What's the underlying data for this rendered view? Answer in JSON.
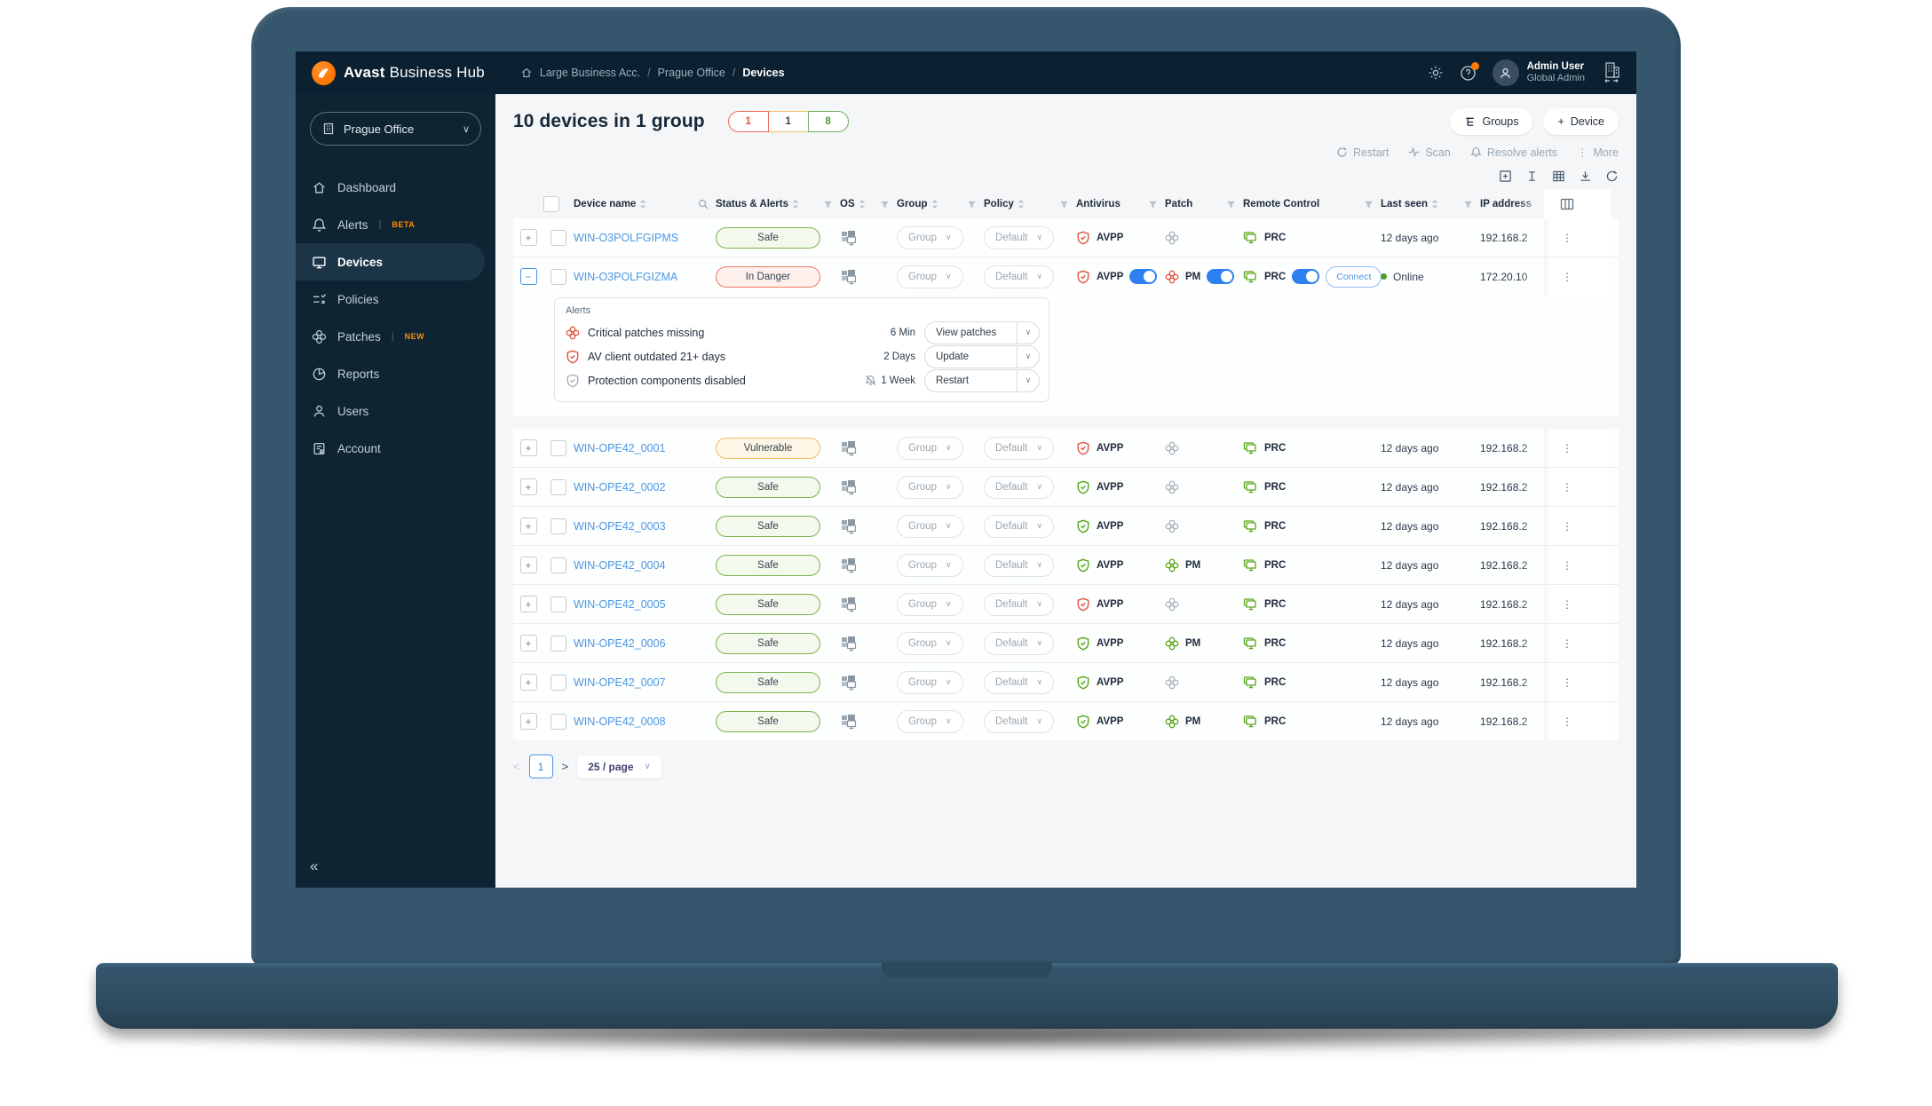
{
  "header": {
    "logo_bold": "Avast",
    "logo_rest": " Business Hub",
    "breadcrumb": [
      "Large Business Acc.",
      "Prague Office",
      "Devices"
    ],
    "user_name": "Admin User",
    "user_role": "Global Admin",
    "icons": [
      "gear-icon",
      "help-icon",
      "avatar",
      "company-switch-icon"
    ]
  },
  "sidebar": {
    "org_selector": "Prague Office",
    "items": [
      {
        "label": "Dashboard",
        "icon": "home",
        "badge": "",
        "active": false
      },
      {
        "label": "Alerts",
        "icon": "bell",
        "badge": "BETA",
        "active": false
      },
      {
        "label": "Devices",
        "icon": "monitor",
        "badge": "",
        "active": true
      },
      {
        "label": "Policies",
        "icon": "policies",
        "badge": "",
        "active": false
      },
      {
        "label": "Patches",
        "icon": "patch",
        "badge": "NEW",
        "active": false
      },
      {
        "label": "Reports",
        "icon": "pie",
        "badge": "",
        "active": false
      },
      {
        "label": "Users",
        "icon": "person",
        "badge": "",
        "active": false
      },
      {
        "label": "Account",
        "icon": "doc",
        "badge": "",
        "active": false
      }
    ],
    "collapse_glyph": "«"
  },
  "main": {
    "title": "10 devices in 1 group",
    "summary_badges": [
      {
        "count": "1",
        "color": "red"
      },
      {
        "count": "1",
        "color": "amber"
      },
      {
        "count": "8",
        "color": "green"
      }
    ],
    "groups_button": "Groups",
    "device_button": "Device",
    "device_button_plus": "+",
    "toolbar": [
      {
        "label": "Restart",
        "icon": "restart"
      },
      {
        "label": "Scan",
        "icon": "scan"
      },
      {
        "label": "Resolve alerts",
        "icon": "bell"
      },
      {
        "label": "More",
        "icon": "more"
      }
    ]
  },
  "table": {
    "columns": {
      "device_name": "Device name",
      "status": "Status & Alerts",
      "os": "OS",
      "group": "Group",
      "policy": "Policy",
      "antivirus": "Antivirus",
      "patch": "Patch",
      "remote": "Remote Control",
      "last_seen": "Last seen",
      "ip": "IP address"
    },
    "rows": [
      {
        "name": "WIN-O3POLFGIPMS",
        "status": "Safe",
        "status_type": "safe",
        "expanded": false,
        "group": "Group",
        "policy": "Default",
        "av": "red",
        "av_label": "AVPP",
        "av_toggle": false,
        "patch": "grey",
        "patch_label": "",
        "patch_toggle": false,
        "rc_label": "PRC",
        "rc_toggle": false,
        "connect": false,
        "last_seen": "12 days ago",
        "online": false,
        "ip": "192.168.2"
      },
      {
        "name": "WIN-O3POLFGIZMA",
        "status": "In Danger",
        "status_type": "danger",
        "expanded": true,
        "group": "Group",
        "policy": "Default",
        "av": "red",
        "av_label": "AVPP",
        "av_toggle": true,
        "patch": "red",
        "patch_label": "PM",
        "patch_toggle": true,
        "rc_label": "PRC",
        "rc_toggle": true,
        "connect": true,
        "connect_label": "Connect",
        "last_seen": "Online",
        "online": true,
        "ip": "172.20.10"
      },
      {
        "name": "WIN-OPE42_0001",
        "status": "Vulnerable",
        "status_type": "vuln",
        "expanded": false,
        "group": "Group",
        "policy": "Default",
        "av": "red",
        "av_label": "AVPP",
        "av_toggle": false,
        "patch": "grey",
        "patch_label": "",
        "patch_toggle": false,
        "rc_label": "PRC",
        "rc_toggle": false,
        "connect": false,
        "last_seen": "12 days ago",
        "online": false,
        "ip": "192.168.2"
      },
      {
        "name": "WIN-OPE42_0002",
        "status": "Safe",
        "status_type": "safe",
        "expanded": false,
        "group": "Group",
        "policy": "Default",
        "av": "green",
        "av_label": "AVPP",
        "av_toggle": false,
        "patch": "grey",
        "patch_label": "",
        "patch_toggle": false,
        "rc_label": "PRC",
        "rc_toggle": false,
        "connect": false,
        "last_seen": "12 days ago",
        "online": false,
        "ip": "192.168.2"
      },
      {
        "name": "WIN-OPE42_0003",
        "status": "Safe",
        "status_type": "safe",
        "expanded": false,
        "group": "Group",
        "policy": "Default",
        "av": "green",
        "av_label": "AVPP",
        "av_toggle": false,
        "patch": "grey",
        "patch_label": "",
        "patch_toggle": false,
        "rc_label": "PRC",
        "rc_toggle": false,
        "connect": false,
        "last_seen": "12 days ago",
        "online": false,
        "ip": "192.168.2"
      },
      {
        "name": "WIN-OPE42_0004",
        "status": "Safe",
        "status_type": "safe",
        "expanded": false,
        "group": "Group",
        "policy": "Default",
        "av": "green",
        "av_label": "AVPP",
        "av_toggle": false,
        "patch": "green",
        "patch_label": "PM",
        "patch_toggle": false,
        "rc_label": "PRC",
        "rc_toggle": false,
        "connect": false,
        "last_seen": "12 days ago",
        "online": false,
        "ip": "192.168.2"
      },
      {
        "name": "WIN-OPE42_0005",
        "status": "Safe",
        "status_type": "safe",
        "expanded": false,
        "group": "Group",
        "policy": "Default",
        "av": "red",
        "av_label": "AVPP",
        "av_toggle": false,
        "patch": "grey",
        "patch_label": "",
        "patch_toggle": false,
        "rc_label": "PRC",
        "rc_toggle": false,
        "connect": false,
        "last_seen": "12 days ago",
        "online": false,
        "ip": "192.168.2"
      },
      {
        "name": "WIN-OPE42_0006",
        "status": "Safe",
        "status_type": "safe",
        "expanded": false,
        "group": "Group",
        "policy": "Default",
        "av": "green",
        "av_label": "AVPP",
        "av_toggle": false,
        "patch": "green",
        "patch_label": "PM",
        "patch_toggle": false,
        "rc_label": "PRC",
        "rc_toggle": false,
        "connect": false,
        "last_seen": "12 days ago",
        "online": false,
        "ip": "192.168.2"
      },
      {
        "name": "WIN-OPE42_0007",
        "status": "Safe",
        "status_type": "safe",
        "expanded": false,
        "group": "Group",
        "policy": "Default",
        "av": "green",
        "av_label": "AVPP",
        "av_toggle": false,
        "patch": "grey",
        "patch_label": "",
        "patch_toggle": false,
        "rc_label": "PRC",
        "rc_toggle": false,
        "connect": false,
        "last_seen": "12 days ago",
        "online": false,
        "ip": "192.168.2"
      },
      {
        "name": "WIN-OPE42_0008",
        "status": "Safe",
        "status_type": "safe",
        "expanded": false,
        "group": "Group",
        "policy": "Default",
        "av": "green",
        "av_label": "AVPP",
        "av_toggle": false,
        "patch": "green",
        "patch_label": "PM",
        "patch_toggle": false,
        "rc_label": "PRC",
        "rc_toggle": false,
        "connect": false,
        "last_seen": "12 days ago",
        "online": false,
        "ip": "192.168.2"
      }
    ]
  },
  "alerts_panel": {
    "title": "Alerts",
    "items": [
      {
        "icon": "patch-red",
        "text": "Critical patches missing",
        "age": "6 Min",
        "muted_bell": false,
        "action": "View patches"
      },
      {
        "icon": "shield-red",
        "text": "AV client outdated 21+ days",
        "age": "2 Days",
        "muted_bell": false,
        "action": "Update"
      },
      {
        "icon": "shield-grey",
        "text": "Protection components disabled",
        "age": "1 Week",
        "muted_bell": true,
        "action": "Restart"
      }
    ]
  },
  "pagination": {
    "prev": "<",
    "page": "1",
    "next": ">",
    "page_size": "25 / page"
  },
  "colors": {
    "accent_orange": "#ff7800",
    "navy": "#0e2433",
    "link_blue": "#4b97e4",
    "toggle_blue": "#2e80f0",
    "safe_green": "#7cb24c",
    "danger_red": "#e2533f",
    "vuln_amber": "#f0bb58"
  }
}
